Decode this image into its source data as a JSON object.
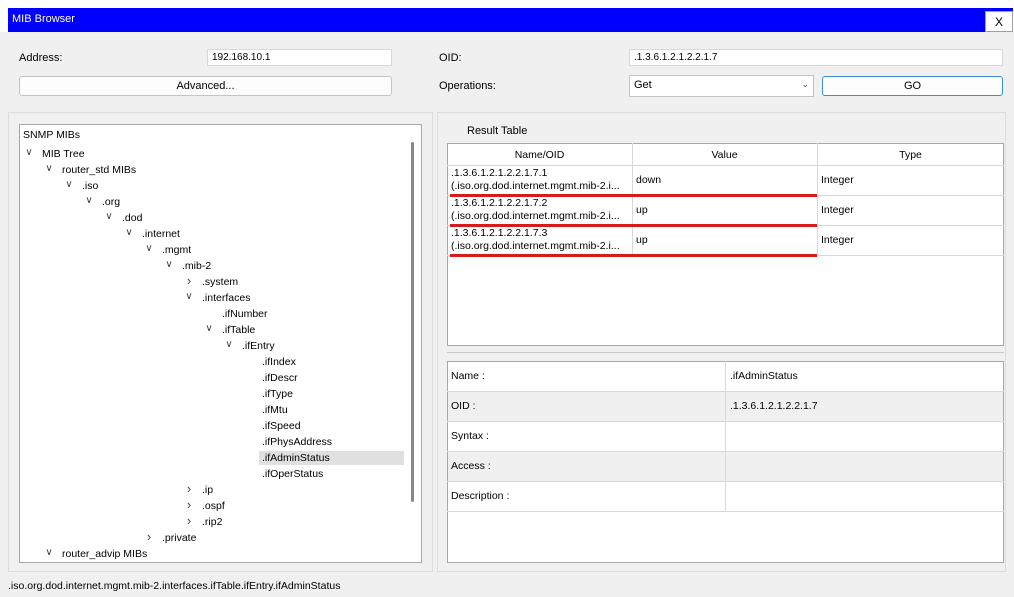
{
  "window": {
    "title": "MIB Browser",
    "close_label": "X"
  },
  "form": {
    "address_label": "Address:",
    "address_value": "192.168.10.1",
    "oid_label": "OID:",
    "oid_value": ".1.3.6.1.2.1.2.2.1.7",
    "advanced_label": "Advanced...",
    "operations_label": "Operations:",
    "operations_value": "Get",
    "go_label": "GO"
  },
  "tree": {
    "root_label": "SNMP MIBs",
    "nodes": [
      "MIB Tree",
      "router_std MIBs",
      ".iso",
      ".org",
      ".dod",
      ".internet",
      ".mgmt",
      ".mib-2",
      ".system",
      ".interfaces",
      ".ifNumber",
      ".ifTable",
      ".ifEntry",
      ".ifIndex",
      ".ifDescr",
      ".ifType",
      ".ifMtu",
      ".ifSpeed",
      ".ifPhysAddress",
      ".ifAdminStatus",
      ".ifOperStatus",
      ".ip",
      ".ospf",
      ".rip2",
      ".private",
      "router_advip MIBs"
    ],
    "selected": ".ifAdminStatus"
  },
  "result": {
    "title": "Result Table",
    "headers": [
      "Name/OID",
      "Value",
      "Type"
    ],
    "rows": [
      {
        "oid": ".1.3.6.1.2.1.2.2.1.7.1",
        "name": "(.iso.org.dod.internet.mgmt.mib-2.i...",
        "value": "down",
        "type": "Integer"
      },
      {
        "oid": ".1.3.6.1.2.1.2.2.1.7.2",
        "name": "(.iso.org.dod.internet.mgmt.mib-2.i...",
        "value": "up",
        "type": "Integer"
      },
      {
        "oid": ".1.3.6.1.2.1.2.2.1.7.3",
        "name": "(.iso.org.dod.internet.mgmt.mib-2.i...",
        "value": "up",
        "type": "Integer"
      }
    ]
  },
  "details": {
    "rows": [
      {
        "label": "Name :",
        "value": ".ifAdminStatus"
      },
      {
        "label": "OID :",
        "value": ".1.3.6.1.2.1.2.2.1.7"
      },
      {
        "label": "Syntax :",
        "value": ""
      },
      {
        "label": "Access :",
        "value": ""
      },
      {
        "label": "Description :",
        "value": ""
      }
    ]
  },
  "status_bar": {
    "path": ".iso.org.dod.internet.mgmt.mib-2.interfaces.ifTable.ifEntry.ifAdminStatus"
  },
  "colors": {
    "titlebar": "#0000ff",
    "highlight": "#d71a1a",
    "go_border": "#3a8fd6"
  }
}
